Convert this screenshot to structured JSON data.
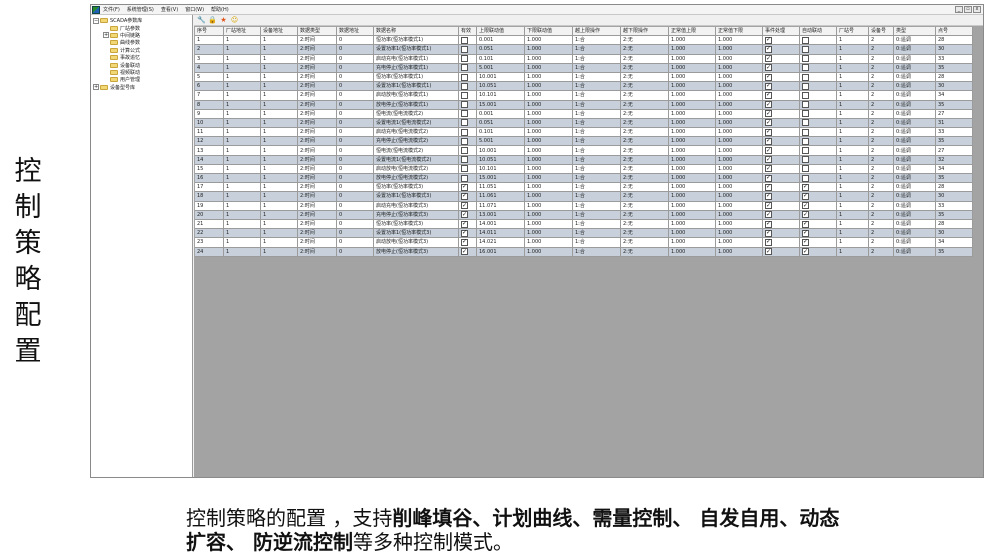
{
  "side_title": [
    "控",
    "制",
    "策",
    "略",
    "配",
    "置"
  ],
  "app": {
    "menu": [
      "文件(F)",
      "系统管理(S)",
      "查看(V)",
      "窗口(W)",
      "帮助(H)"
    ],
    "window_controls": [
      "_",
      "▫",
      "x"
    ],
    "toolbar_icons": [
      "wrench-icon",
      "lock-icon",
      "star-icon",
      "smiley-icon"
    ]
  },
  "tree": [
    {
      "label": "SCADA参数库",
      "indent": 0,
      "expander": "⊟"
    },
    {
      "label": "厂站参数",
      "indent": 1,
      "expander": ""
    },
    {
      "label": "中间链路",
      "indent": 1,
      "expander": "⊞"
    },
    {
      "label": "曲线参数",
      "indent": 1,
      "expander": ""
    },
    {
      "label": "计算公式",
      "indent": 1,
      "expander": ""
    },
    {
      "label": "事故追忆",
      "indent": 1,
      "expander": ""
    },
    {
      "label": "设备联动",
      "indent": 1,
      "expander": ""
    },
    {
      "label": "视频联动",
      "indent": 1,
      "expander": ""
    },
    {
      "label": "用户管理",
      "indent": 1,
      "expander": ""
    },
    {
      "label": "设备型号库",
      "indent": 0,
      "expander": "⊞"
    }
  ],
  "grid": {
    "columns": [
      "序号",
      "厂站地址",
      "设备地址",
      "数据类型",
      "数据地址",
      "数据名称",
      "有效",
      "上限联动值",
      "下限联动值",
      "越上限操作",
      "越下限操作",
      "正常值上限",
      "正常值下限",
      "事件处理",
      "自动联动",
      "厂站号",
      "设备号",
      "类型",
      "点号"
    ],
    "rows": [
      [
        "1",
        "1",
        "1",
        "2:时间",
        "0",
        "恒功率(恒功率模式1)",
        false,
        "0.001",
        "1.000",
        "1:合",
        "2:无",
        "1.000",
        "1.000",
        true,
        false,
        "1",
        "2",
        "0:遥调",
        "28"
      ],
      [
        "2",
        "1",
        "1",
        "2:时间",
        "0",
        "设置功率1(恒功率模式1)",
        false,
        "0.051",
        "1.000",
        "1:合",
        "2:无",
        "1.000",
        "1.000",
        true,
        false,
        "1",
        "2",
        "0:遥调",
        "30"
      ],
      [
        "3",
        "1",
        "1",
        "2:时间",
        "0",
        "启动充电(恒功率模式1)",
        false,
        "0.101",
        "1.000",
        "1:合",
        "2:无",
        "1.000",
        "1.000",
        true,
        false,
        "1",
        "2",
        "0:遥调",
        "33"
      ],
      [
        "4",
        "1",
        "1",
        "2:时间",
        "0",
        "充电停止(恒功率模式1)",
        false,
        "5.001",
        "1.000",
        "1:合",
        "2:无",
        "1.000",
        "1.000",
        true,
        false,
        "1",
        "2",
        "0:遥调",
        "35"
      ],
      [
        "5",
        "1",
        "1",
        "2:时间",
        "0",
        "恒功率(恒功率模式1)",
        false,
        "10.001",
        "1.000",
        "1:合",
        "2:无",
        "1.000",
        "1.000",
        true,
        false,
        "1",
        "2",
        "0:遥调",
        "28"
      ],
      [
        "6",
        "1",
        "1",
        "2:时间",
        "0",
        "设置功率1(恒功率模式1)",
        false,
        "10.051",
        "1.000",
        "1:合",
        "2:无",
        "1.000",
        "1.000",
        true,
        false,
        "1",
        "2",
        "0:遥调",
        "30"
      ],
      [
        "7",
        "1",
        "1",
        "2:时间",
        "0",
        "启动放电(恒功率模式1)",
        false,
        "10.101",
        "1.000",
        "1:合",
        "2:无",
        "1.000",
        "1.000",
        true,
        false,
        "1",
        "2",
        "0:遥调",
        "34"
      ],
      [
        "8",
        "1",
        "1",
        "2:时间",
        "0",
        "放电停止(恒功率模式1)",
        false,
        "15.001",
        "1.000",
        "1:合",
        "2:无",
        "1.000",
        "1.000",
        true,
        false,
        "1",
        "2",
        "0:遥调",
        "35"
      ],
      [
        "9",
        "1",
        "1",
        "2:时间",
        "0",
        "恒电流(恒电流模式2)",
        false,
        "0.001",
        "1.000",
        "1:合",
        "2:无",
        "1.000",
        "1.000",
        true,
        false,
        "1",
        "2",
        "0:遥调",
        "27"
      ],
      [
        "10",
        "1",
        "1",
        "2:时间",
        "0",
        "设置电流1(恒电流模式2)",
        false,
        "0.051",
        "1.000",
        "1:合",
        "2:无",
        "1.000",
        "1.000",
        true,
        false,
        "1",
        "2",
        "0:遥调",
        "31"
      ],
      [
        "11",
        "1",
        "1",
        "2:时间",
        "0",
        "启动充电(恒电流模式2)",
        false,
        "0.101",
        "1.000",
        "1:合",
        "2:无",
        "1.000",
        "1.000",
        true,
        false,
        "1",
        "2",
        "0:遥调",
        "33"
      ],
      [
        "12",
        "1",
        "1",
        "2:时间",
        "0",
        "充电停止(恒电流模式2)",
        false,
        "5.001",
        "1.000",
        "1:合",
        "2:无",
        "1.000",
        "1.000",
        true,
        false,
        "1",
        "2",
        "0:遥调",
        "35"
      ],
      [
        "13",
        "1",
        "1",
        "2:时间",
        "0",
        "恒电流(恒电流模式2)",
        false,
        "10.001",
        "1.000",
        "1:合",
        "2:无",
        "1.000",
        "1.000",
        true,
        false,
        "1",
        "2",
        "0:遥调",
        "27"
      ],
      [
        "14",
        "1",
        "1",
        "2:时间",
        "0",
        "设置电流1(恒电流模式2)",
        false,
        "10.051",
        "1.000",
        "1:合",
        "2:无",
        "1.000",
        "1.000",
        true,
        false,
        "1",
        "2",
        "0:遥调",
        "32"
      ],
      [
        "15",
        "1",
        "1",
        "2:时间",
        "0",
        "启动放电(恒电流模式2)",
        false,
        "10.101",
        "1.000",
        "1:合",
        "2:无",
        "1.000",
        "1.000",
        true,
        false,
        "1",
        "2",
        "0:遥调",
        "34"
      ],
      [
        "16",
        "1",
        "1",
        "2:时间",
        "0",
        "放电停止(恒电流模式2)",
        false,
        "15.001",
        "1.000",
        "1:合",
        "2:无",
        "1.000",
        "1.000",
        true,
        false,
        "1",
        "2",
        "0:遥调",
        "35"
      ],
      [
        "17",
        "1",
        "1",
        "2:时间",
        "0",
        "恒功率(恒功率模式3)",
        true,
        "11.051",
        "1.000",
        "1:合",
        "2:无",
        "1.000",
        "1.000",
        true,
        true,
        "1",
        "2",
        "0:遥调",
        "28"
      ],
      [
        "18",
        "1",
        "1",
        "2:时间",
        "0",
        "设置功率1(恒功率模式3)",
        true,
        "11.061",
        "1.000",
        "1:合",
        "2:无",
        "1.000",
        "1.000",
        true,
        true,
        "1",
        "2",
        "0:遥调",
        "30"
      ],
      [
        "19",
        "1",
        "1",
        "2:时间",
        "0",
        "启动充电(恒功率模式3)",
        true,
        "11.071",
        "1.000",
        "1:合",
        "2:无",
        "1.000",
        "1.000",
        true,
        true,
        "1",
        "2",
        "0:遥调",
        "33"
      ],
      [
        "20",
        "1",
        "1",
        "2:时间",
        "0",
        "充电停止(恒功率模式3)",
        true,
        "13.001",
        "1.000",
        "1:合",
        "2:无",
        "1.000",
        "1.000",
        true,
        true,
        "1",
        "2",
        "0:遥调",
        "35"
      ],
      [
        "21",
        "1",
        "1",
        "2:时间",
        "0",
        "恒功率(恒功率模式3)",
        true,
        "14.001",
        "1.000",
        "1:合",
        "2:无",
        "1.000",
        "1.000",
        true,
        true,
        "1",
        "2",
        "0:遥调",
        "28"
      ],
      [
        "22",
        "1",
        "1",
        "2:时间",
        "0",
        "设置功率1(恒功率模式3)",
        true,
        "14.011",
        "1.000",
        "1:合",
        "2:无",
        "1.000",
        "1.000",
        true,
        true,
        "1",
        "2",
        "0:遥调",
        "30"
      ],
      [
        "23",
        "1",
        "1",
        "2:时间",
        "0",
        "启动放电(恒功率模式3)",
        true,
        "14.021",
        "1.000",
        "1:合",
        "2:无",
        "1.000",
        "1.000",
        true,
        true,
        "1",
        "2",
        "0:遥调",
        "34"
      ],
      [
        "24",
        "1",
        "1",
        "2:时间",
        "0",
        "放电停止(恒功率模式3)",
        true,
        "16.001",
        "1.000",
        "1:合",
        "2:无",
        "1.000",
        "1.000",
        true,
        true,
        "1",
        "2",
        "0:遥调",
        "35"
      ]
    ]
  },
  "caption": {
    "line1_prefix": "控制策略的配置 ，支持",
    "line1_bold": "削峰填谷、计划曲线、需量控制、 自发自用、动态",
    "line2_bold": "扩容、 防逆流控制",
    "line2_suffix": "等多种控制模式。"
  }
}
